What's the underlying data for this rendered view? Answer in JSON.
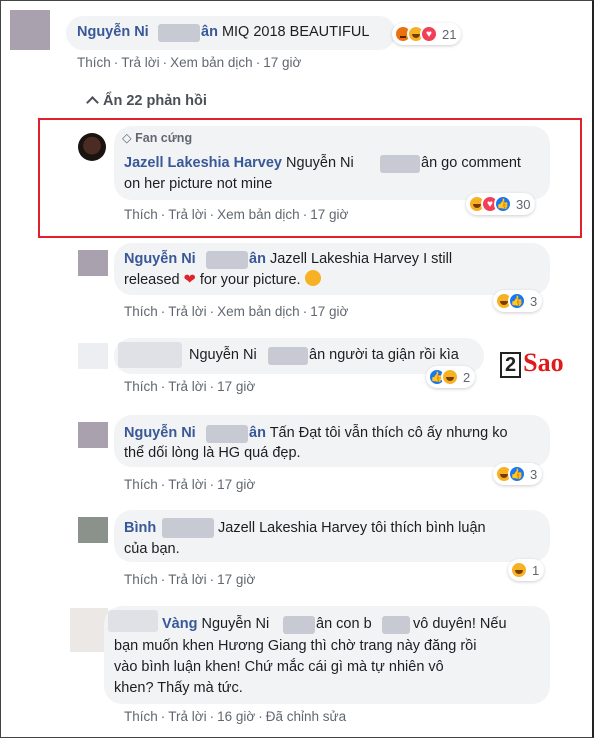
{
  "actions": {
    "like": "Thích",
    "reply": "Trả lời",
    "translate": "Xem bản dịch",
    "edited": "Đã chỉnh sửa"
  },
  "top_comment": {
    "name": "Nguyễn Ni",
    "name_end": "ân",
    "text": "MIQ 2018 BEAUTIFUL",
    "reaction_count": "21",
    "time": "17 giờ"
  },
  "toggle_label": "Ẩn 22 phản hồi",
  "replies": [
    {
      "badge": "Fan cứng",
      "name": "Jazell Lakeshia Harvey",
      "line1": "Nguyễn Ni",
      "line1_end": "ân go comment",
      "line2": "on her picture not mine",
      "reaction_count": "30",
      "time": "17 giờ"
    },
    {
      "name": "Nguyễn Ni",
      "name_end": "ân",
      "line1": "Jazell Lakeshia Harvey I still",
      "line2": "released",
      "line2_end": "for your picture.",
      "reaction_count": "3",
      "time": "17 giờ"
    },
    {
      "line1": "Nguyễn Ni",
      "line1_end": "ân người ta giận rồi kìa",
      "reaction_count": "2",
      "time": "17 giờ"
    },
    {
      "name": "Nguyễn Ni",
      "name_end": "ân",
      "line1": "Tấn Đạt tôi vẫn thích cô ấy nhưng ko",
      "line2": "thể dối lòng là HG quá đẹp.",
      "reaction_count": "3",
      "time": "17 giờ"
    },
    {
      "name": "Bình",
      "line1": "Jazell Lakeshia Harvey tôi thích bình luận",
      "line2": "của bạn.",
      "reaction_count": "1",
      "time": "17 giờ"
    },
    {
      "name": "Vàng",
      "line1": "Nguyễn Ni",
      "line1_mid": "ân con b",
      "line1_end": "vô duyên! Nếu",
      "line2": "bạn muốn khen Hương Giang thì chờ trang này đăng rồi",
      "line3": "vào bình luận khen! Chứ mắc cái gì mà tự nhiên vô",
      "line4": "khen? Thấy mà tức.",
      "time": "16 giờ"
    }
  ],
  "watermark": {
    "digit": "2",
    "word": "Sao"
  }
}
